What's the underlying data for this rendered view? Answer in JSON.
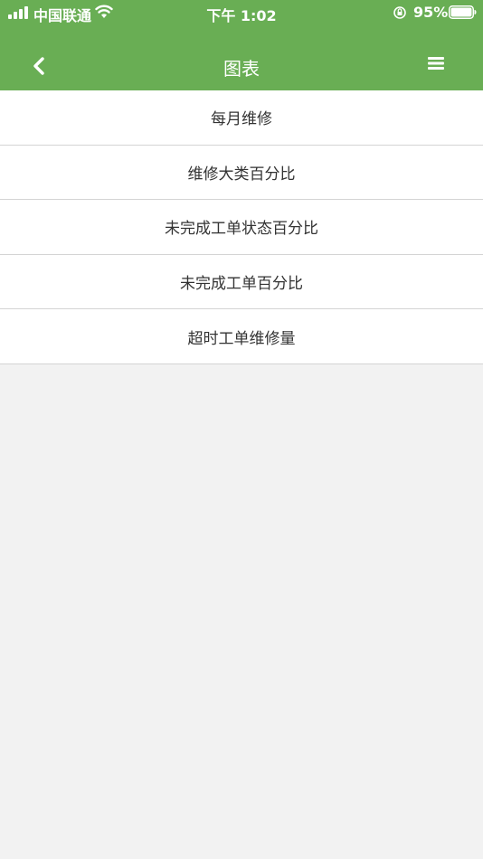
{
  "status_bar": {
    "carrier": "中国联通",
    "time": "下午 1:02",
    "battery_percent": "95%"
  },
  "nav": {
    "title": "图表",
    "back_icon": "chevron-left-icon",
    "menu_icon": "hamburger-menu-icon"
  },
  "list": {
    "items": [
      {
        "label": "每月维修"
      },
      {
        "label": "维修大类百分比"
      },
      {
        "label": "未完成工单状态百分比"
      },
      {
        "label": "未完成工单百分比"
      },
      {
        "label": "超时工单维修量"
      }
    ]
  },
  "colors": {
    "header": "#69ae54",
    "background": "#f2f2f2"
  }
}
